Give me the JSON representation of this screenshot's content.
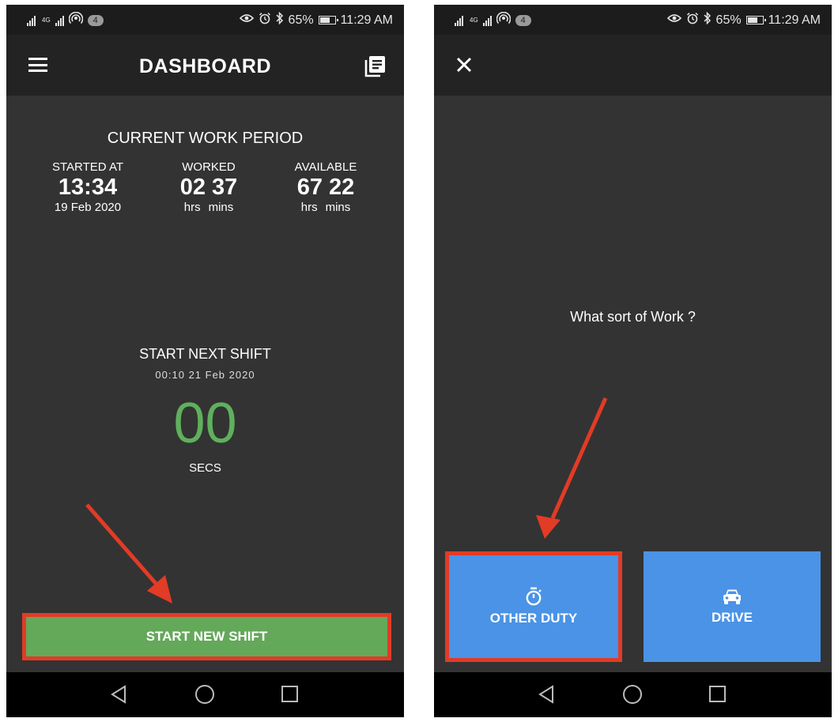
{
  "status_bar": {
    "network_label": "4G",
    "hotspot_badge": "4",
    "battery_text": "65%",
    "time": "11:29 AM"
  },
  "dashboard": {
    "title": "DASHBOARD",
    "work_period": {
      "title": "CURRENT WORK PERIOD",
      "started": {
        "label": "STARTED AT",
        "value": "13:34",
        "date": "19 Feb 2020"
      },
      "worked": {
        "label": "WORKED",
        "value": "02 37",
        "unit_hrs": "hrs",
        "unit_mins": "mins"
      },
      "available": {
        "label": "AVAILABLE",
        "value": "67 22",
        "unit_hrs": "hrs",
        "unit_mins": "mins"
      }
    },
    "next_shift": {
      "title": "START NEXT SHIFT",
      "datetime": "00:10 21 Feb 2020",
      "seconds": "00",
      "unit": "SECS"
    },
    "start_button": "START NEW SHIFT"
  },
  "work_type": {
    "question": "What sort of Work ?",
    "other_duty_label": "OTHER DUTY",
    "drive_label": "DRIVE"
  },
  "colors": {
    "accent_green": "#64a85a",
    "accent_blue": "#4a93e6",
    "highlight_red": "#e23b26"
  }
}
